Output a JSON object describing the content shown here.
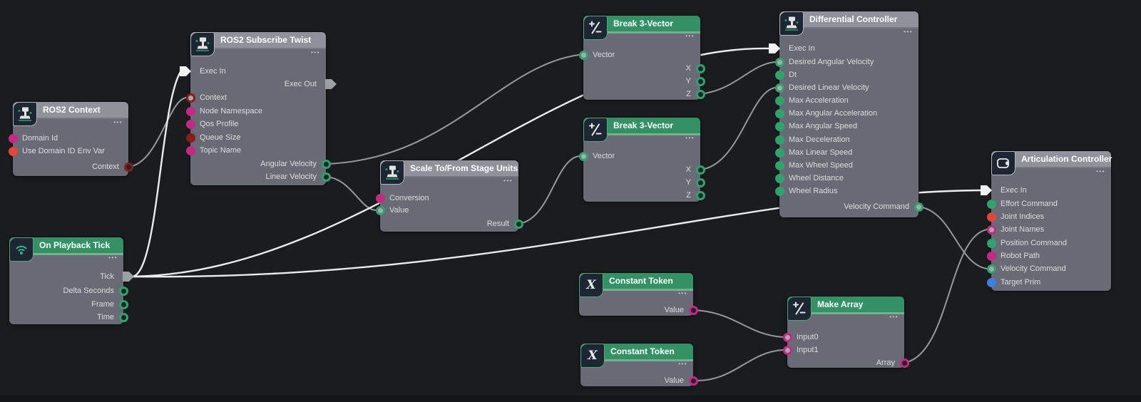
{
  "canvas": {
    "background": "#1b1c1e"
  },
  "palette": {
    "node_body": "#686b76",
    "header_gray": "#8f929a",
    "header_green": "#349065",
    "port_green": "#2fa36e",
    "port_magenta": "#c42a84",
    "port_red": "#e2463c",
    "port_dark_red": "#8a1c1c",
    "port_blue": "#3d7de4",
    "exec_white": "#f0f0f0",
    "exec_gray": "#9ba0a5",
    "wire_data": "#97989b",
    "wire_exec": "#ececec"
  },
  "ui": {
    "menu_dots": "•••"
  },
  "nodes": [
    {
      "title": "ROS2 Context",
      "icon": "ros2-robot-icon",
      "ports": [
        {
          "label": "Domain Id"
        },
        {
          "label": "Use Domain ID Env Var"
        },
        {
          "label": "Context"
        }
      ]
    },
    {
      "title": "ROS2 Subscribe Twist",
      "icon": "ros2-robot-icon",
      "ports": [
        {
          "label": "Exec In"
        },
        {
          "label": "Exec Out"
        },
        {
          "label": "Context"
        },
        {
          "label": "Node Namespace"
        },
        {
          "label": "Qos Profile"
        },
        {
          "label": "Queue Size"
        },
        {
          "label": "Topic Name"
        },
        {
          "label": "Angular Velocity"
        },
        {
          "label": "Linear Velocity"
        }
      ]
    },
    {
      "title": "On Playback Tick",
      "icon": "broadcast-icon",
      "ports": [
        {
          "label": "Tick"
        },
        {
          "label": "Delta Seconds"
        },
        {
          "label": "Frame"
        },
        {
          "label": "Time"
        }
      ]
    },
    {
      "title": "Scale To/From Stage Units",
      "icon": "ros2-robot-icon",
      "ports": [
        {
          "label": "Conversion"
        },
        {
          "label": "Value"
        },
        {
          "label": "Result"
        }
      ]
    },
    {
      "title": "Break 3-Vector",
      "icon": "math-icon",
      "ports": [
        {
          "label": "Vector"
        },
        {
          "label": "X"
        },
        {
          "label": "Y"
        },
        {
          "label": "Z"
        }
      ]
    },
    {
      "title": "Break 3-Vector",
      "icon": "math-icon",
      "ports": [
        {
          "label": "Vector"
        },
        {
          "label": "X"
        },
        {
          "label": "Y"
        },
        {
          "label": "Z"
        }
      ]
    },
    {
      "title": "Differential Controller",
      "icon": "ros2-robot-icon",
      "ports": [
        {
          "label": "Exec In"
        },
        {
          "label": "Desired Angular Velocity"
        },
        {
          "label": "Dt"
        },
        {
          "label": "Desired Linear Velocity"
        },
        {
          "label": "Max Acceleration"
        },
        {
          "label": "Max Angular Acceleration"
        },
        {
          "label": "Max Angular Speed"
        },
        {
          "label": "Max Deceleration"
        },
        {
          "label": "Max Linear Speed"
        },
        {
          "label": "Max Wheel Speed"
        },
        {
          "label": "Wheel Distance"
        },
        {
          "label": "Wheel Radius"
        },
        {
          "label": "Velocity Command"
        }
      ]
    },
    {
      "title": "Articulation Controller",
      "icon": "controller-icon",
      "ports": [
        {
          "label": "Exec In"
        },
        {
          "label": "Effort Command"
        },
        {
          "label": "Joint Indices"
        },
        {
          "label": "Joint Names"
        },
        {
          "label": "Position Command"
        },
        {
          "label": "Robot Path"
        },
        {
          "label": "Velocity Command"
        },
        {
          "label": "Target Prim"
        }
      ]
    },
    {
      "title": "Constant Token",
      "icon": "token-x-icon",
      "ports": [
        {
          "label": "Value"
        }
      ]
    },
    {
      "title": "Constant Token",
      "icon": "token-x-icon",
      "ports": [
        {
          "label": "Value"
        }
      ]
    },
    {
      "title": "Make Array",
      "icon": "math-icon",
      "ports": [
        {
          "label": "Input0"
        },
        {
          "label": "Input1"
        },
        {
          "label": "Array"
        }
      ]
    }
  ],
  "connections": [
    {
      "from": "On Playback Tick.Tick",
      "to": "ROS2 Subscribe Twist.Exec In"
    },
    {
      "from": "On Playback Tick.Tick",
      "to": "Differential Controller.Exec In"
    },
    {
      "from": "On Playback Tick.Tick",
      "to": "Articulation Controller.Exec In"
    },
    {
      "from": "ROS2 Context.Context",
      "to": "ROS2 Subscribe Twist.Context"
    },
    {
      "from": "ROS2 Subscribe Twist.Angular Velocity",
      "to": "Break 3-Vector.Vector"
    },
    {
      "from": "ROS2 Subscribe Twist.Linear Velocity",
      "to": "Scale To/From Stage Units.Value"
    },
    {
      "from": "Scale To/From Stage Units.Result",
      "to": "Break 3-Vector (2).Vector"
    },
    {
      "from": "Break 3-Vector.Z",
      "to": "Differential Controller.Desired Angular Velocity"
    },
    {
      "from": "Break 3-Vector (2).X",
      "to": "Differential Controller.Desired Linear Velocity"
    },
    {
      "from": "Differential Controller.Velocity Command",
      "to": "Articulation Controller.Velocity Command"
    },
    {
      "from": "Constant Token.Value",
      "to": "Make Array.Input0"
    },
    {
      "from": "Constant Token (2).Value",
      "to": "Make Array.Input1"
    },
    {
      "from": "Make Array.Array",
      "to": "Articulation Controller.Joint Names"
    }
  ]
}
